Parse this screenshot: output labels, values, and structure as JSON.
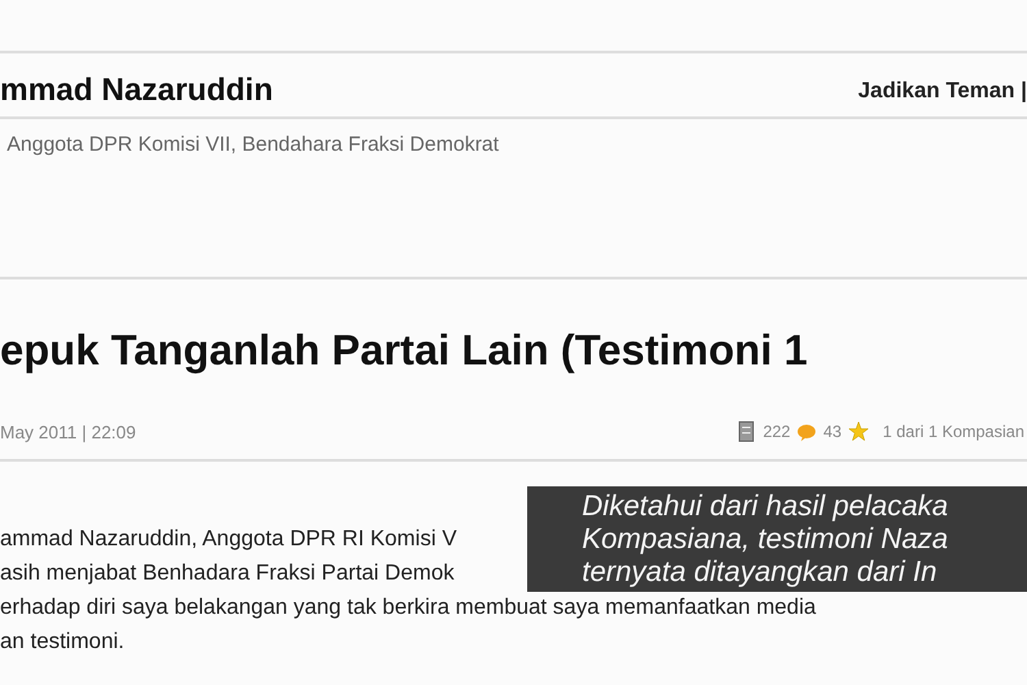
{
  "profile": {
    "name": "mmad Nazaruddin",
    "action": "Jadikan Teman |",
    "bio": "Anggota DPR Komisi VII, Bendahara Fraksi Demokrat"
  },
  "article": {
    "title": "epuk Tanganlah Partai Lain (Testimoni 1",
    "date": "May 2011 | 22:09",
    "reads": "222",
    "comments": "43",
    "rating": "1 dari 1 Kompasian",
    "body": [
      "ammad Nazaruddin, Anggota DPR RI Komisi V",
      "asih menjabat Benhadara Fraksi Partai Demok",
      "erhadap diri saya belakangan yang tak berkira membuat saya memanfaatkan media",
      "an testimoni."
    ]
  },
  "caption": {
    "lines": [
      "Diketahui dari hasil pelacaka",
      "Kompasiana, testimoni Naza",
      "ternyata ditayangkan dari In"
    ]
  }
}
